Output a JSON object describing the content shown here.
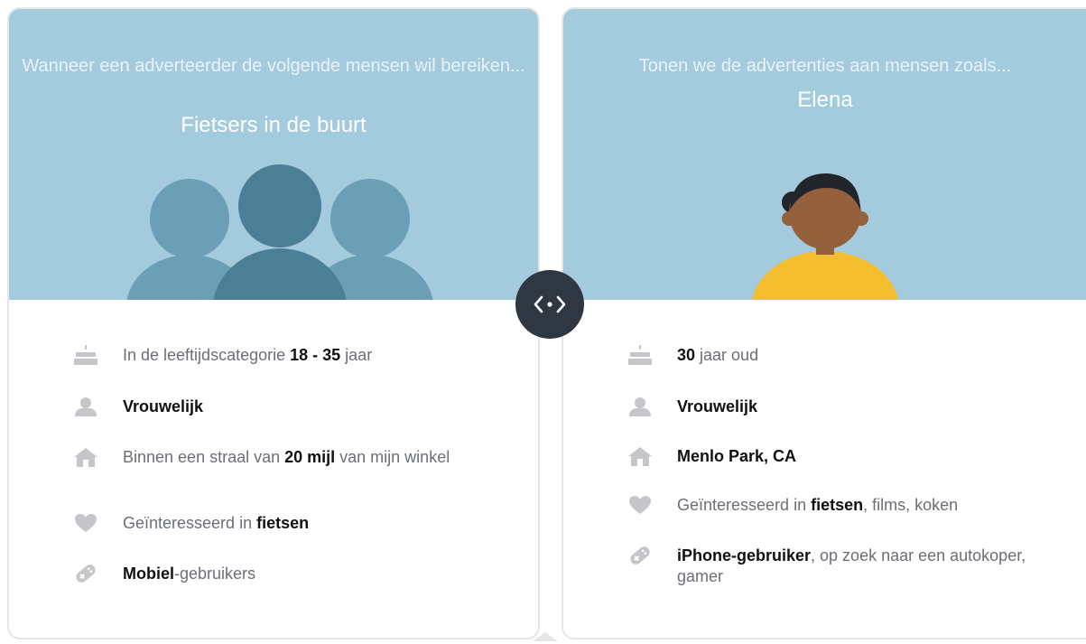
{
  "left_card": {
    "intro": "Wanneer een adverteerder de volgende mensen wil bereiken...",
    "headline": "Fietsers in de buurt",
    "rows": [
      {
        "icon": "birthday-cake-icon",
        "pre": "In de leeftijdscategorie ",
        "bold": "18 - 35",
        "post": " jaar"
      },
      {
        "icon": "person-icon",
        "pre": "",
        "bold": "Vrouwelijk",
        "post": ""
      },
      {
        "icon": "house-icon",
        "pre": "Binnen een straal van ",
        "bold": "20 mijl",
        "post": " van mijn winkel"
      },
      {
        "icon": "heart-icon",
        "pre": "Geïnteresseerd in ",
        "bold": "fietsen",
        "post": ""
      },
      {
        "icon": "gamepad-icon",
        "pre": "",
        "bold": "Mobiel",
        "post": "-gebruikers"
      }
    ]
  },
  "right_card": {
    "intro": "Tonen we de advertenties aan mensen zoals...",
    "headline": "Elena",
    "rows": [
      {
        "icon": "birthday-cake-icon",
        "pre": "",
        "bold": "30",
        "post": " jaar oud"
      },
      {
        "icon": "person-icon",
        "pre": "",
        "bold": "Vrouwelijk",
        "post": ""
      },
      {
        "icon": "house-icon",
        "pre": "",
        "bold": "Menlo Park, CA",
        "post": ""
      },
      {
        "icon": "heart-icon",
        "pre": "Geïnteresseerd in ",
        "bold": "fietsen",
        "post": ", films, koken"
      },
      {
        "icon": "gamepad-icon",
        "pre": "",
        "bold": "iPhone-gebruiker",
        "post": ", op zoek naar een autokoper, gamer"
      }
    ]
  },
  "toggle": {
    "icon": "code-arrows-icon"
  },
  "colors": {
    "hero_bg": "#a4cbdd",
    "crowd_light": "#6a9fb6",
    "crowd_dark": "#4b7f96",
    "skin": "#94613c",
    "hair": "#22262c",
    "shirt": "#f3bd2e",
    "icon_gray": "#c4c6ca",
    "toggle_bg": "#2f3842"
  }
}
